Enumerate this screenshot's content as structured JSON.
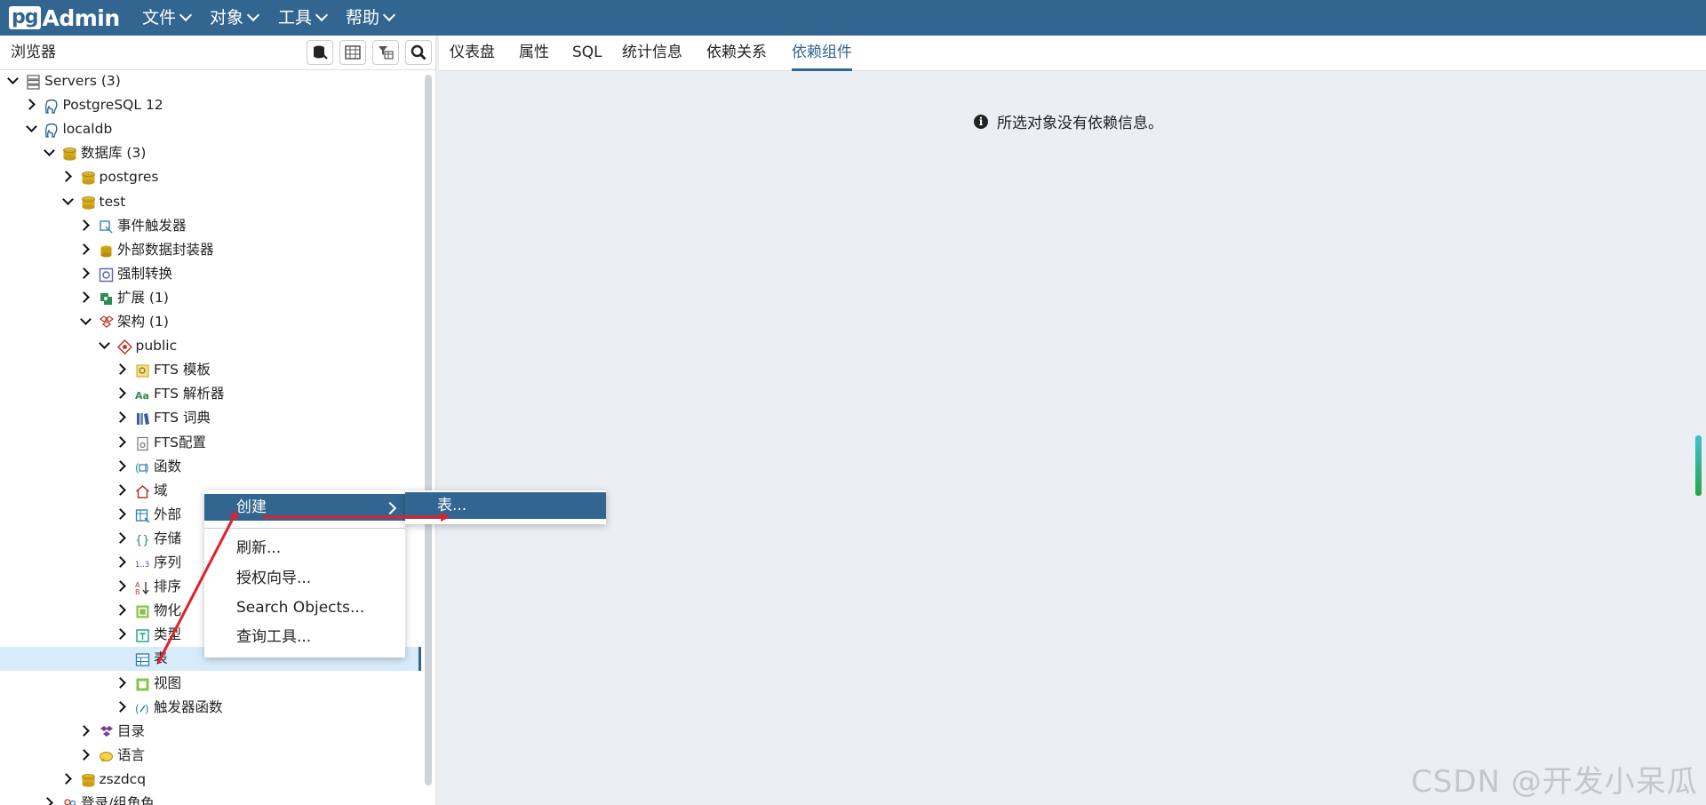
{
  "app": {
    "logo_pg": "pg",
    "logo_admin": "Admin"
  },
  "menu": [
    "文件",
    "对象",
    "工具",
    "帮助"
  ],
  "browser": {
    "title": "浏览器"
  },
  "tree": [
    {
      "label": "Servers (3)",
      "level": 0,
      "tw": "d",
      "icon": "servers-icon"
    },
    {
      "label": "PostgreSQL 12",
      "level": 1,
      "tw": "r",
      "icon": "elephant-icon"
    },
    {
      "label": "localdb",
      "level": 1,
      "tw": "d",
      "icon": "elephant-icon"
    },
    {
      "label": "数据库 (3)",
      "level": 2,
      "tw": "d",
      "icon": "database-icon"
    },
    {
      "label": "postgres",
      "level": 3,
      "tw": "r",
      "icon": "database-icon"
    },
    {
      "label": "test",
      "level": 3,
      "tw": "d",
      "icon": "database-icon"
    },
    {
      "label": "事件触发器",
      "level": 4,
      "tw": "r",
      "icon": "event-trigger-icon"
    },
    {
      "label": "外部数据封装器",
      "level": 4,
      "tw": "r",
      "icon": "foreign-data-wrapper-icon"
    },
    {
      "label": "强制转换",
      "level": 4,
      "tw": "r",
      "icon": "cast-icon"
    },
    {
      "label": "扩展 (1)",
      "level": 4,
      "tw": "r",
      "icon": "extension-icon"
    },
    {
      "label": "架构 (1)",
      "level": 4,
      "tw": "d",
      "icon": "schema-icon"
    },
    {
      "label": "public",
      "level": 5,
      "tw": "d",
      "icon": "public-schema-icon"
    },
    {
      "label": "FTS 模板",
      "level": 6,
      "tw": "r",
      "icon": "fts-template-icon"
    },
    {
      "label": "FTS 解析器",
      "level": 6,
      "tw": "r",
      "icon": "fts-parser-icon"
    },
    {
      "label": "FTS 词典",
      "level": 6,
      "tw": "r",
      "icon": "fts-dictionary-icon"
    },
    {
      "label": "FTS配置",
      "level": 6,
      "tw": "r",
      "icon": "fts-config-icon"
    },
    {
      "label": "函数",
      "level": 6,
      "tw": "r",
      "icon": "function-icon"
    },
    {
      "label": "域",
      "level": 6,
      "tw": "r",
      "icon": "domain-icon"
    },
    {
      "label": "外部",
      "level": 6,
      "tw": "r",
      "icon": "foreign-table-icon"
    },
    {
      "label": "存储",
      "level": 6,
      "tw": "r",
      "icon": "procedure-icon"
    },
    {
      "label": "序列",
      "level": 6,
      "tw": "r",
      "icon": "sequence-icon"
    },
    {
      "label": "排序",
      "level": 6,
      "tw": "r",
      "icon": "collation-icon"
    },
    {
      "label": "物化",
      "level": 6,
      "tw": "r",
      "icon": "materialized-view-icon"
    },
    {
      "label": "类型",
      "level": 6,
      "tw": "r",
      "icon": "type-icon"
    },
    {
      "label": "表",
      "level": 6,
      "tw": "",
      "icon": "table-icon",
      "selected": true
    },
    {
      "label": "视图",
      "level": 6,
      "tw": "r",
      "icon": "view-icon"
    },
    {
      "label": "触发器函数",
      "level": 6,
      "tw": "r",
      "icon": "trigger-function-icon"
    },
    {
      "label": "目录",
      "level": 4,
      "tw": "r",
      "icon": "catalog-icon"
    },
    {
      "label": "语言",
      "level": 4,
      "tw": "r",
      "icon": "language-icon"
    },
    {
      "label": "zszdcq",
      "level": 3,
      "tw": "r",
      "icon": "database-icon"
    },
    {
      "label": "登录/组角色",
      "level": 2,
      "tw": "r",
      "icon": "role-icon"
    }
  ],
  "tabs": [
    {
      "label": "仪表盘",
      "active": false
    },
    {
      "label": "属性",
      "active": false
    },
    {
      "label": "SQL",
      "active": false
    },
    {
      "label": "统计信息",
      "active": false
    },
    {
      "label": "依赖关系",
      "active": false
    },
    {
      "label": "依赖组件",
      "active": true
    }
  ],
  "info_message": "所选对象没有依赖信息。",
  "info_glyph": "i",
  "context_menu": {
    "create": "创建",
    "items": [
      "刷新...",
      "授权向导...",
      "Search Objects...",
      "查询工具..."
    ]
  },
  "submenu": {
    "table": "表..."
  },
  "watermark": "CSDN @开发小呆瓜",
  "colors": {
    "brand": "#326690",
    "selected_row": "#d7ebfb",
    "arrow": "#e0202a",
    "background": "#ebeef3"
  }
}
